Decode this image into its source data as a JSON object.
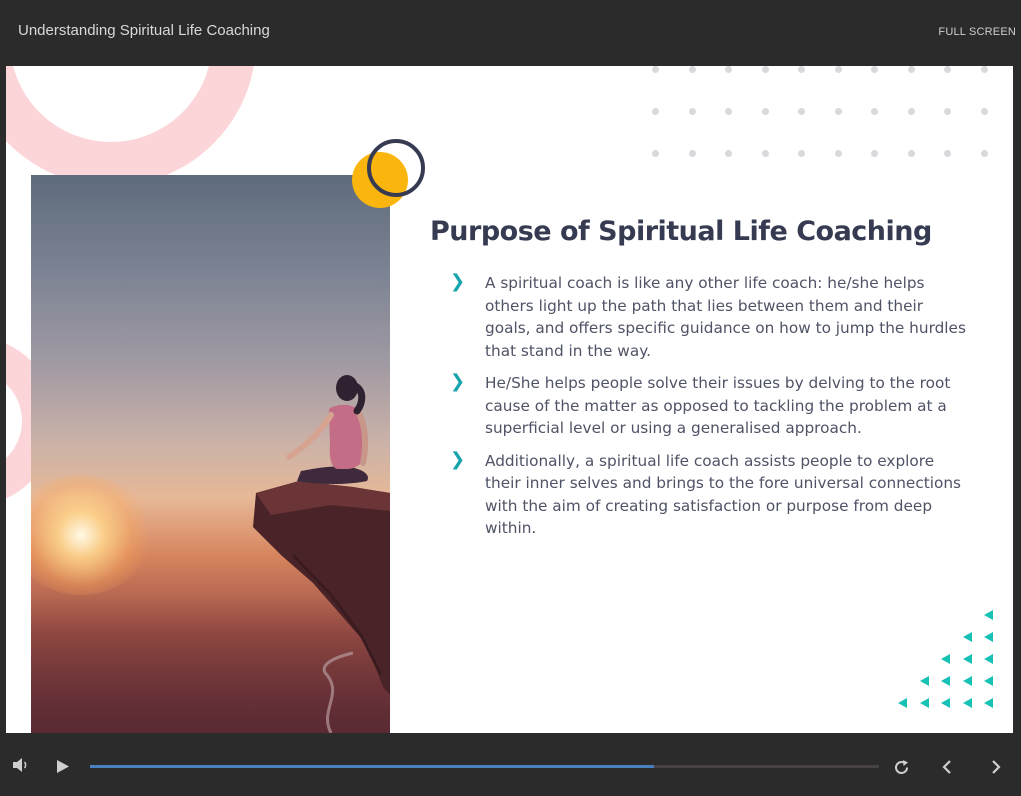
{
  "header": {
    "course_title": "Understanding Spiritual Life Coaching",
    "fullscreen_label": "FULL SCREEN"
  },
  "slide": {
    "title": "Purpose of Spiritual Life Coaching",
    "bullets": [
      "A spiritual coach is like any other life coach: he/she helps others light up the path that lies between them and their goals, and offers specific guidance on how to jump the hurdles that stand in the way.",
      "He/She helps people solve their issues by delving to the root cause of the matter as opposed to tackling the problem at a superficial level or using a generalised approach.",
      "Additionally, a spiritual life coach assists people to explore their inner selves and brings to the fore universal connections with the aim of creating satisfaction or purpose from deep within."
    ],
    "bullet_icon": "chevron-right-icon"
  },
  "player": {
    "progress_fraction": 0.715,
    "icons": [
      "volume-icon",
      "play-icon",
      "replay-icon",
      "previous-icon",
      "next-icon"
    ]
  },
  "colors": {
    "accent_teal": "#18a4ad",
    "title_navy": "#363b52",
    "accent_yellow": "#fbb50f",
    "accent_pink": "#fcd5d9",
    "progress_blue": "#4a7fc0"
  }
}
